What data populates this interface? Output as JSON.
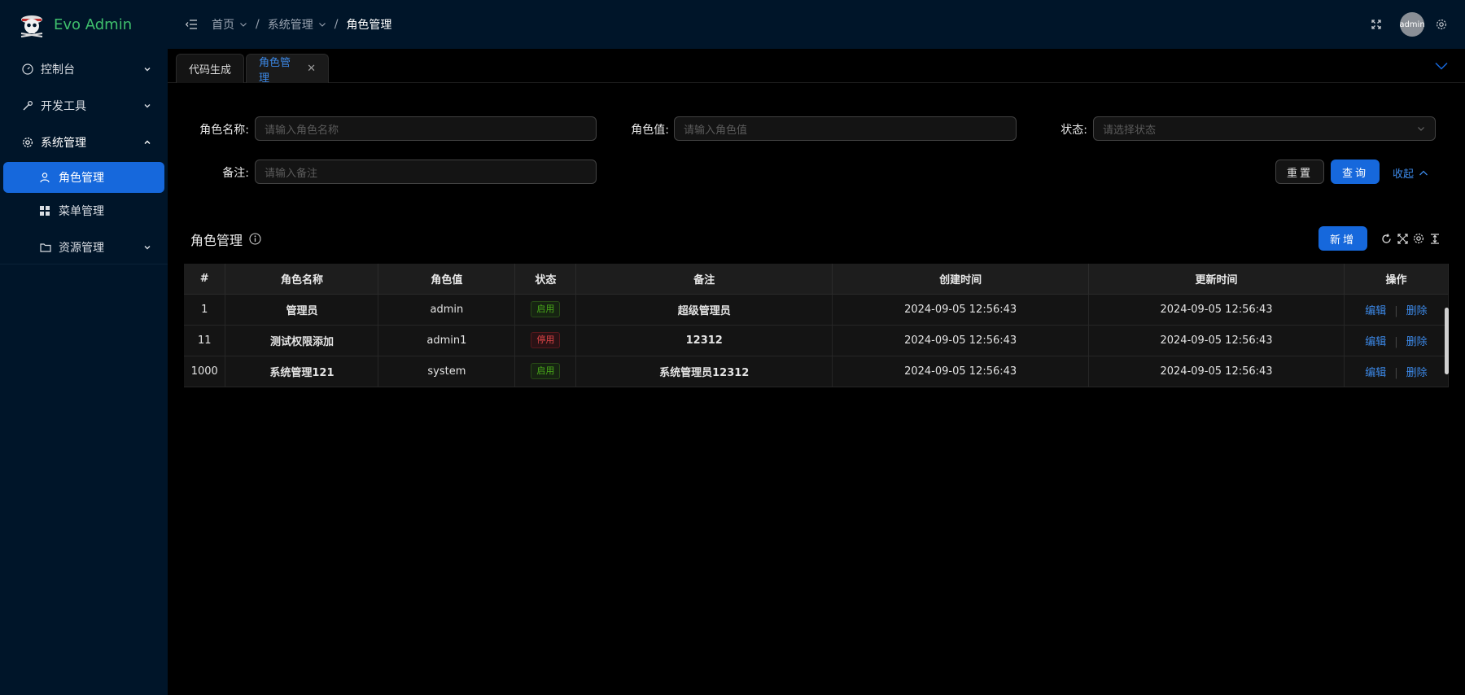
{
  "app": {
    "title": "Evo Admin"
  },
  "sidebar": {
    "items": [
      {
        "label": "控制台",
        "icon": "dashboard-icon"
      },
      {
        "label": "开发工具",
        "icon": "tool-icon"
      },
      {
        "label": "系统管理",
        "icon": "gear-icon",
        "children": [
          {
            "label": "角色管理",
            "icon": "user-icon",
            "active": true
          },
          {
            "label": "菜单管理",
            "icon": "grid-icon"
          }
        ]
      },
      {
        "label": "资源管理",
        "icon": "folder-icon"
      }
    ]
  },
  "header": {
    "breadcrumb": [
      "首页",
      "系统管理",
      "角色管理"
    ],
    "avatar_text": "admin"
  },
  "tabs": [
    {
      "label": "代码生成"
    },
    {
      "label": "角色管理",
      "active": true
    }
  ],
  "search": {
    "role_name_label": "角色名称:",
    "role_name_placeholder": "请输入角色名称",
    "role_value_label": "角色值:",
    "role_value_placeholder": "请输入角色值",
    "status_label": "状态:",
    "status_placeholder": "请选择状态",
    "remark_label": "备注:",
    "remark_placeholder": "请输入备注",
    "reset_label": "重置",
    "query_label": "查询",
    "collapse_label": "收起"
  },
  "table": {
    "title": "角色管理",
    "new_label": "新增",
    "columns": [
      "#",
      "角色名称",
      "角色值",
      "状态",
      "备注",
      "创建时间",
      "更新时间",
      "操作"
    ],
    "rows": [
      {
        "id": "1",
        "name": "管理员",
        "value": "admin",
        "status": "启用",
        "status_color": "#49aa19",
        "remark": "超级管理员",
        "created": "2024-09-05 12:56:43",
        "updated": "2024-09-05 12:56:43"
      },
      {
        "id": "11",
        "name": "测试权限添加",
        "value": "admin1",
        "status": "停用",
        "status_color": "#dc4446",
        "remark": "12312",
        "created": "2024-09-05 12:56:43",
        "updated": "2024-09-05 12:56:43"
      },
      {
        "id": "1000",
        "name": "系统管理121",
        "value": "system",
        "status": "启用",
        "status_color": "#49aa19",
        "remark": "系统管理员12312",
        "created": "2024-09-05 12:56:43",
        "updated": "2024-09-05 12:56:43"
      }
    ],
    "edit_label": "编辑",
    "delete_label": "删除"
  },
  "colors": {
    "accent": "#1668dc",
    "sidebar_bg": "#001529",
    "logo_green": "#3fc06d"
  }
}
